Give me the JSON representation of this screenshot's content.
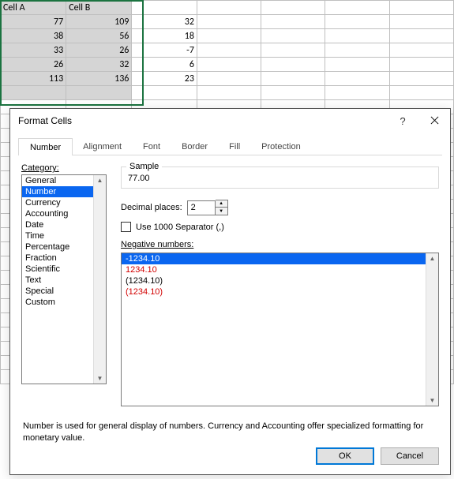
{
  "sheet": {
    "headers": [
      "Cell A",
      "Cell B",
      ""
    ],
    "rows": [
      [
        "77",
        "109",
        "32"
      ],
      [
        "38",
        "56",
        "18"
      ],
      [
        "33",
        "26",
        "-7"
      ],
      [
        "26",
        "32",
        "6"
      ],
      [
        "113",
        "136",
        "23"
      ]
    ]
  },
  "dialog": {
    "title": "Format Cells",
    "help_glyph": "?",
    "tabs": [
      "Number",
      "Alignment",
      "Font",
      "Border",
      "Fill",
      "Protection"
    ],
    "active_tab": "Number",
    "category_label": "Category:",
    "categories": [
      "General",
      "Number",
      "Currency",
      "Accounting",
      "Date",
      "Time",
      "Percentage",
      "Fraction",
      "Scientific",
      "Text",
      "Special",
      "Custom"
    ],
    "selected_category": "Number",
    "sample_label": "Sample",
    "sample_value": "77.00",
    "decimal_label": "Decimal places:",
    "decimal_value": "2",
    "separator_label": "Use 1000 Separator (,)",
    "neg_label": "Negative numbers:",
    "neg_items": [
      {
        "text": "-1234.10",
        "red": false,
        "selected": true
      },
      {
        "text": "1234.10",
        "red": true,
        "selected": false
      },
      {
        "text": "(1234.10)",
        "red": false,
        "selected": false
      },
      {
        "text": "(1234.10)",
        "red": true,
        "selected": false
      }
    ],
    "help_text": "Number is used for general display of numbers.  Currency and Accounting offer specialized formatting for monetary value.",
    "ok": "OK",
    "cancel": "Cancel"
  }
}
